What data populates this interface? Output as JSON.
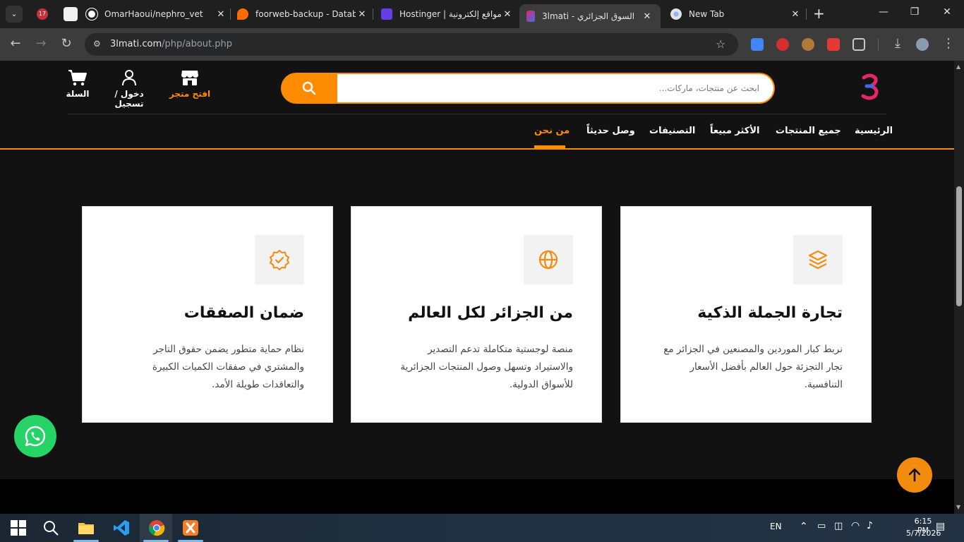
{
  "browser": {
    "tab_badge": "17",
    "tabs": [
      {
        "title": "OmarHaoui/nephro_vet",
        "close": "✕"
      },
      {
        "title": "foorweb-backup - Databa",
        "close": "✕"
      },
      {
        "title": "Hostinger | مواقع إلكترونية",
        "close": "✕"
      },
      {
        "title": "3lmati - السوق الجزائري",
        "close": "✕"
      },
      {
        "title": "New Tab",
        "close": "✕"
      }
    ],
    "new_tab": "+",
    "window_controls": {
      "minimize": "—",
      "restore": "❐",
      "close": "✕"
    },
    "url_host": "3lmati.com",
    "url_path": "/php/about.php"
  },
  "header": {
    "search_placeholder": "ابحث عن منتجات، ماركات...",
    "open_store": "افتح متجر",
    "login": "دخول / تسجيل",
    "cart": "السلة"
  },
  "nav": {
    "items": [
      "الرئيسية",
      "جميع المنتجات",
      "الأكثر مبيعاً",
      "التصنيفات",
      "وصل حديثاً",
      "من نحن"
    ],
    "active": "من نحن"
  },
  "cards": [
    {
      "icon": "layers-icon",
      "title": "تجارة الجملة الذكية",
      "desc": "نربط كبار الموردين والمصنعين في الجزائر مع تجار التجزئة حول العالم بأفضل الأسعار التنافسية."
    },
    {
      "icon": "globe-icon",
      "title": "من الجزائر لكل العالم",
      "desc": "منصة لوجستية متكاملة تدعم التصدير والاستيراد وتسهل وصول المنتجات الجزائرية للأسواق الدولية."
    },
    {
      "icon": "badge-check-icon",
      "title": "ضمان الصفقات",
      "desc": "نظام حماية متطور يضمن حقوق التاجر والمشتري في صفقات الكميات الكبيرة والتعاقدات طويلة الأمد."
    }
  ],
  "colors": {
    "accent": "#ff8c00",
    "background": "#121212",
    "card": "#ffffff",
    "whatsapp": "#25d366"
  },
  "taskbar": {
    "language": "EN",
    "time": "6:15 PM",
    "date": "5/7/2026"
  }
}
